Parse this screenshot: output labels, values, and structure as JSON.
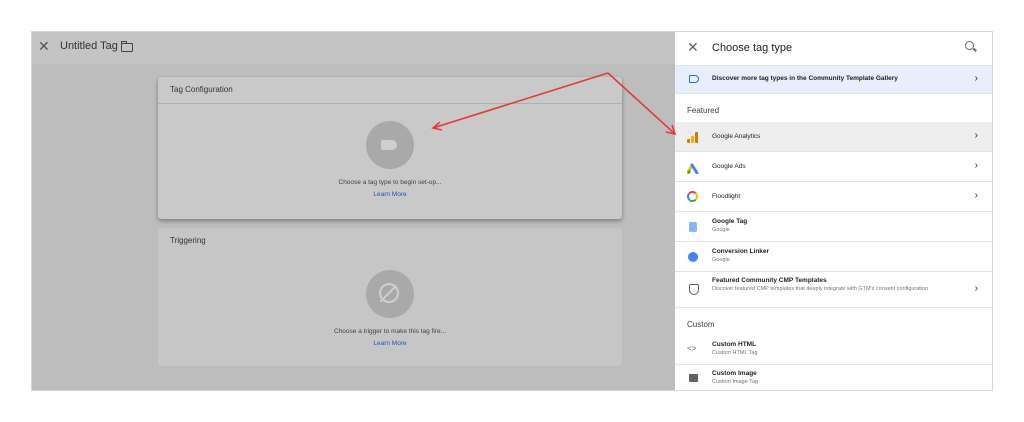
{
  "editor": {
    "title": "Untitled Tag",
    "config_card": {
      "title": "Tag Configuration",
      "prompt": "Choose a tag type to begin set-up...",
      "link": "Learn More"
    },
    "trigger_card": {
      "title": "Triggering",
      "prompt": "Choose a trigger to make this tag fire...",
      "link": "Learn More"
    }
  },
  "panel": {
    "title": "Choose tag type",
    "discover": "Discover more tag types in the Community Template Gallery",
    "featured_label": "Featured",
    "custom_label": "Custom",
    "featured": [
      {
        "title": "Google Analytics",
        "sub": "",
        "icon": "google-analytics-icon"
      },
      {
        "title": "Google Ads",
        "sub": "",
        "icon": "google-ads-icon"
      },
      {
        "title": "Floodlight",
        "sub": "",
        "icon": "floodlight-icon"
      },
      {
        "title": "Google Tag",
        "sub": "Google",
        "icon": "google-tag-icon"
      },
      {
        "title": "Conversion Linker",
        "sub": "Google",
        "icon": "conversion-linker-icon"
      },
      {
        "title": "Featured Community CMP Templates",
        "sub": "Discover featured CMP templates that deeply integrate with GTM's consent configuration",
        "icon": "shield-icon"
      }
    ],
    "custom": [
      {
        "title": "Custom HTML",
        "sub": "Custom HTML Tag",
        "icon": "code-icon"
      },
      {
        "title": "Custom Image",
        "sub": "Custom Image Tag",
        "icon": "image-icon"
      }
    ]
  },
  "colors": {
    "accent": "#1a73e8",
    "annotation_arrow": "#e53935",
    "link": "#1a56b8"
  }
}
